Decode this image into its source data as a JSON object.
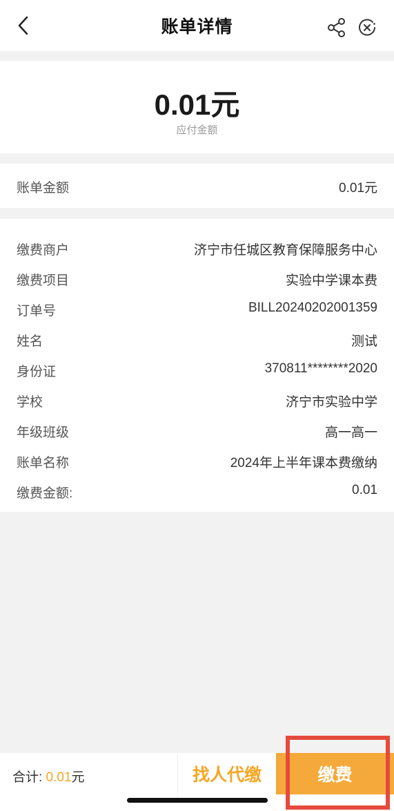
{
  "navbar": {
    "title": "账单详情",
    "icons": {
      "back": "chevron-left-icon",
      "share": "share-icon",
      "close": "close-circle-icon"
    }
  },
  "amount": {
    "value": "0.01元",
    "label": "应付金额"
  },
  "bill": {
    "label": "账单金额",
    "value": "0.01元"
  },
  "details": [
    {
      "label": "缴费商户",
      "value": "济宁市任城区教育保障服务中心"
    },
    {
      "label": "缴费项目",
      "value": "实验中学课本费"
    },
    {
      "label": "订单号",
      "value": "BILL20240202001359"
    },
    {
      "label": "姓名",
      "value": "测试"
    },
    {
      "label": "身份证",
      "value": "370811********2020"
    },
    {
      "label": "学校",
      "value": "济宁市实验中学"
    },
    {
      "label": "年级班级",
      "value": "高一高一"
    },
    {
      "label": "账单名称",
      "value": "2024年上半年课本费缴纳"
    },
    {
      "label": "缴费金额:",
      "value": "0.01"
    }
  ],
  "footer": {
    "total_label": "合计:",
    "total_amount": "0.01",
    "total_unit": "元",
    "proxy_label": "找人代缴",
    "pay_label": "缴费"
  },
  "colors": {
    "accent": "#f5a623",
    "pay_button": "#f5a93a",
    "highlight": "#e64a3c"
  }
}
